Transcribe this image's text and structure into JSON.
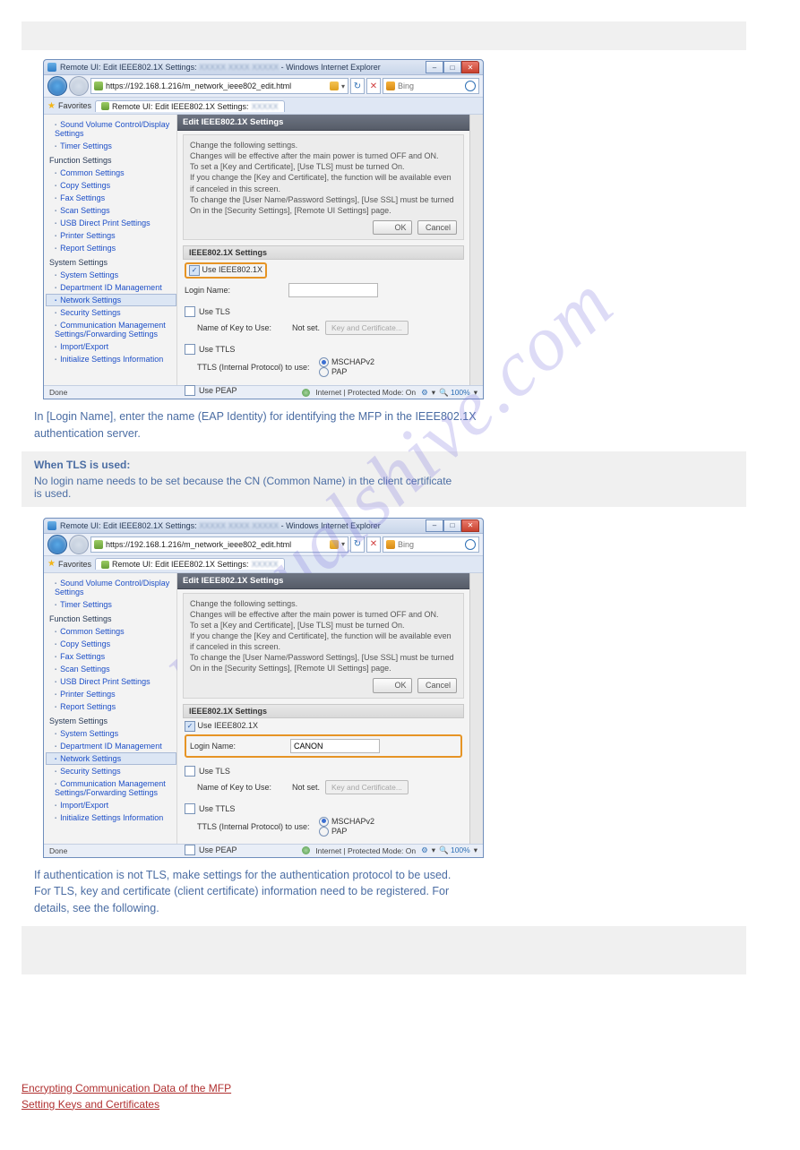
{
  "watermark": "manualshive.com",
  "bands": {
    "empty": " "
  },
  "caption1": "In [Login Name], enter the name (EAP Identity) for identifying the MFP in the IEEE802.1X\nauthentication server.",
  "note1_title": "When TLS is used:",
  "note1_body": "No login name needs to be set because the CN (Common Name) in the client certificate\nis used.",
  "caption2": "If authentication is not TLS, make settings for the authentication protocol to be used.\nFor TLS, key and certificate (client certificate) information need to be registered. For\ndetails, see the following.",
  "bottom_links": {
    "a": "Encrypting Communication Data of the MFP",
    "b": "Setting Keys and Certificates"
  },
  "shot1": {
    "title_prefix": "Remote UI: Edit IEEE802.1X Settings:",
    "title_suffix": "- Windows Internet Explorer",
    "url": "https://192.168.1.216/m_network_ieee802_edit.html",
    "search_engine": "Bing",
    "fav_label": "Favorites",
    "tab_label": "Remote UI: Edit IEEE802.1X Settings:",
    "sidebar": {
      "link_sound": "Sound Volume Control/Display Settings",
      "link_timer": "Timer Settings",
      "group_func": "Function Settings",
      "link_common": "Common Settings",
      "link_copy": "Copy Settings",
      "link_fax": "Fax Settings",
      "link_scan": "Scan Settings",
      "link_usb": "USB Direct Print Settings",
      "link_printer": "Printer Settings",
      "link_report": "Report Settings",
      "group_sys": "System Settings",
      "link_system": "System Settings",
      "link_dept": "Department ID Management",
      "link_net": "Network Settings",
      "link_sec": "Security Settings",
      "link_comm": "Communication Management Settings/Forwarding Settings",
      "link_impexp": "Import/Export",
      "link_init": "Initialize Settings Information"
    },
    "panel": {
      "heading": "Edit IEEE802.1X Settings",
      "info": "Change the following settings.\nChanges will be effective after the main power is turned OFF and ON.\nTo set a [Key and Certificate], [Use TLS] must be turned On.\nIf you change the [Key and Certificate], the function will be available even if canceled in this screen.\nTo change the [User Name/Password Settings], [Use SSL] must be turned On in the [Security Settings], [Remote UI Settings] page.",
      "btn_ok": "OK",
      "btn_cancel": "Cancel",
      "section": "IEEE802.1X Settings",
      "use_8021x": "Use IEEE802.1X",
      "login_label": "Login Name:",
      "login_value": "",
      "use_tls": "Use TLS",
      "key_label": "Name of Key to Use:",
      "not_set": "Not set.",
      "keycert_btn": "Key and Certificate...",
      "use_ttls": "Use TTLS",
      "ttls_proto": "TTLS (Internal Protocol) to use:",
      "mschap": "MSCHAPv2",
      "pap": "PAP",
      "use_peap": "Use PEAP"
    },
    "status": {
      "done": "Done",
      "mode": "Internet | Protected Mode: On",
      "zoom": "100%"
    }
  },
  "shot2": {
    "login_value": "CANON"
  }
}
